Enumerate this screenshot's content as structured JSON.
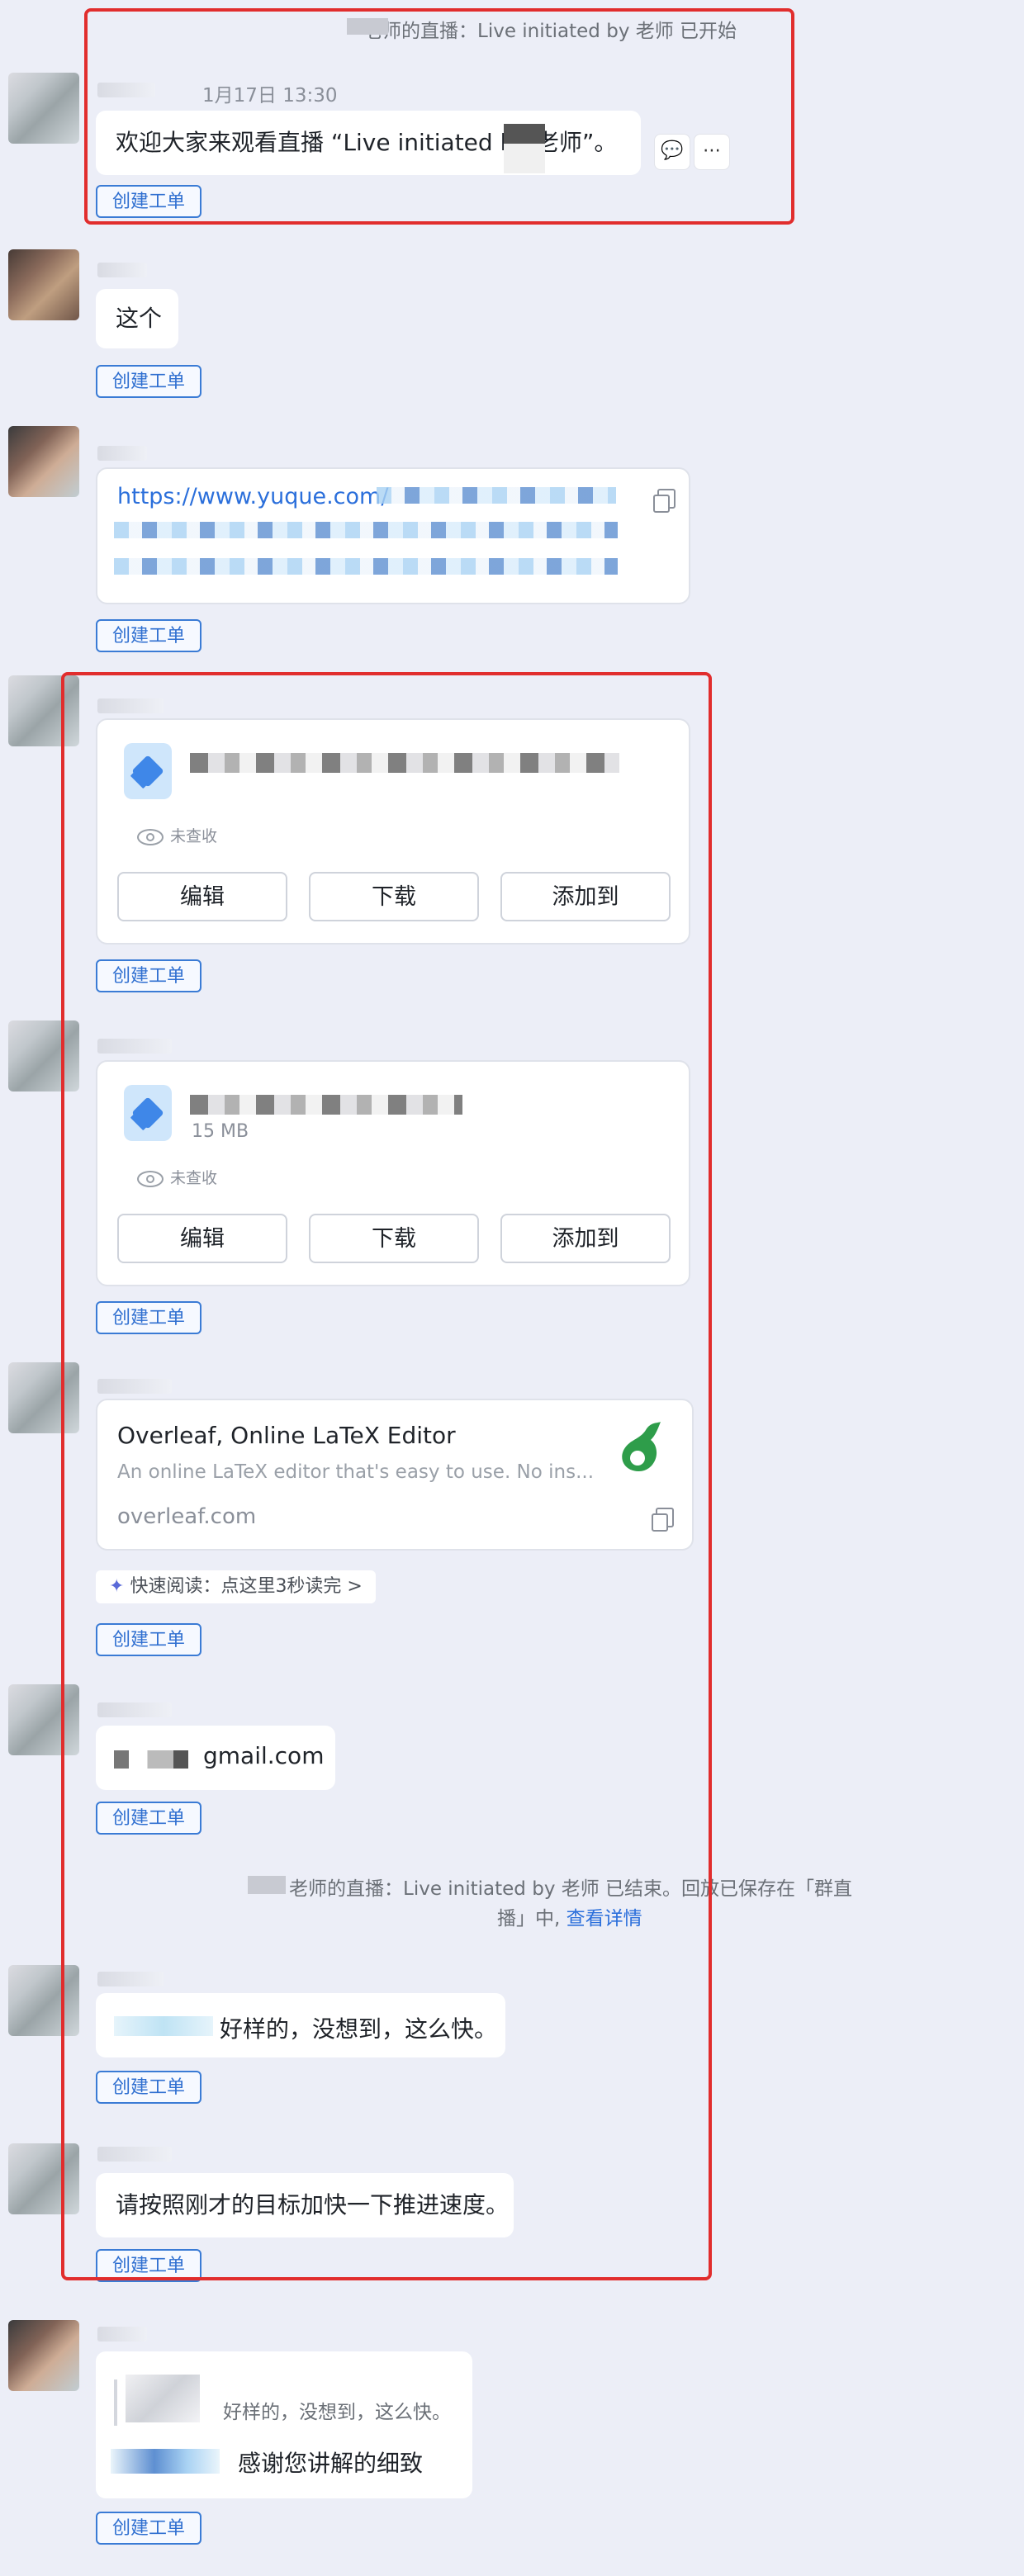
{
  "colors": {
    "background": "#eceef7",
    "accent": "#2b6fdb",
    "highlight_box": "#e12d2d"
  },
  "system_top": {
    "live_started": "老师的直播：Live initiated by 老师 已开始"
  },
  "msg1": {
    "timestamp": "1月17日 13:30",
    "text": "欢迎大家来观看直播 “Live initiated by     老师”。",
    "reply_icon": "comment-icon",
    "more_icon": "more-icon"
  },
  "ticket_label": "创建工单",
  "msg2": {
    "text": "这个"
  },
  "msg3": {
    "url": "https://www.yuque.com/"
  },
  "file1": {
    "unread": "未查收",
    "buttons": [
      "编辑",
      "下载",
      "添加到"
    ]
  },
  "file2": {
    "size": "15 MB",
    "unread": "未查收",
    "buttons": [
      "编辑",
      "下载",
      "添加到"
    ]
  },
  "link_card": {
    "title": "Overleaf, Online LaTeX Editor",
    "desc": "An online LaTeX editor that's easy to use. No ins...",
    "domain": "overleaf.com"
  },
  "quick_read": "快速阅读：点这里3秒读完 >",
  "email_msg": {
    "text": "gmail.com"
  },
  "system_end": {
    "line1": "老师的直播：Live initiated by     老师 已结束。回放已保存在「群直",
    "line2_prefix": "播」中,",
    "line2_link": "查看详情"
  },
  "msg_good": {
    "text": "好样的，没想到，这么快。"
  },
  "msg_speed": {
    "text": "请按照刚才的目标加快一下推进速度。"
  },
  "msg_quote": {
    "quoted": "好样的，没想到，这么快。",
    "text": "感谢您讲解的细致"
  }
}
